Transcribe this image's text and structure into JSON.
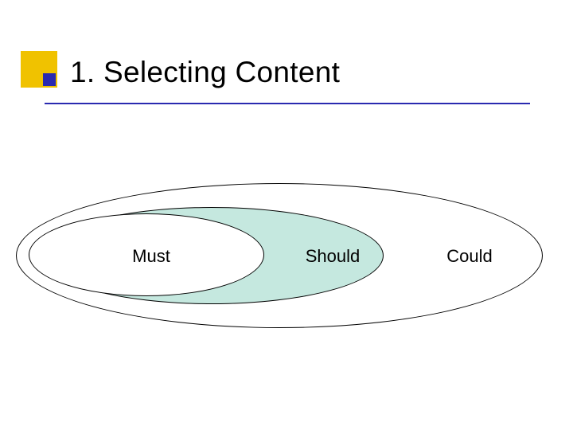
{
  "title": "1. Selecting Content",
  "labels": {
    "must": "Must",
    "should": "Should",
    "could": "Could"
  },
  "colors": {
    "accent_yellow": "#f0c200",
    "accent_blue": "#2a2ab0",
    "ellipse_mid_fill": "#c5e8df"
  }
}
